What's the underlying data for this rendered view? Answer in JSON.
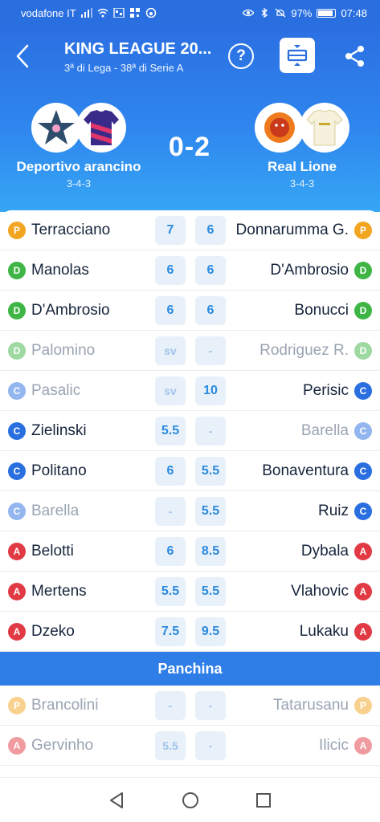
{
  "status": {
    "carrier": "vodafone IT",
    "battery": "97%",
    "time": "07:48"
  },
  "header": {
    "title": "KING LEAGUE 20...",
    "subtitle": "3ª di Lega - 38ª di Serie A",
    "help_label": "?"
  },
  "match": {
    "home": {
      "name": "Deportivo arancino",
      "formation": "3-4-3"
    },
    "away": {
      "name": "Real Lione",
      "formation": "3-4-3"
    },
    "score": "0-2"
  },
  "starters": [
    {
      "home_role": "P",
      "home_name": "Terracciano",
      "home_vote": "7",
      "away_vote": "6",
      "away_name": "Donnarumma G.",
      "away_role": "P",
      "home_dim": false,
      "away_dim": false
    },
    {
      "home_role": "D",
      "home_name": "Manolas",
      "home_vote": "6",
      "away_vote": "6",
      "away_name": "D'Ambrosio",
      "away_role": "D",
      "home_dim": false,
      "away_dim": false
    },
    {
      "home_role": "D",
      "home_name": "D'Ambrosio",
      "home_vote": "6",
      "away_vote": "6",
      "away_name": "Bonucci",
      "away_role": "D",
      "home_dim": false,
      "away_dim": false
    },
    {
      "home_role": "D",
      "home_name": "Palomino",
      "home_vote": "sv",
      "away_vote": "-",
      "away_name": "Rodriguez R.",
      "away_role": "D",
      "home_dim": true,
      "away_dim": true
    },
    {
      "home_role": "C",
      "home_name": "Pasalic",
      "home_vote": "sv",
      "away_vote": "10",
      "away_name": "Perisic",
      "away_role": "C",
      "home_dim": true,
      "away_dim": false
    },
    {
      "home_role": "C",
      "home_name": "Zielinski",
      "home_vote": "5.5",
      "away_vote": "-",
      "away_name": "Barella",
      "away_role": "C",
      "home_dim": false,
      "away_dim": true
    },
    {
      "home_role": "C",
      "home_name": "Politano",
      "home_vote": "6",
      "away_vote": "5.5",
      "away_name": "Bonaventura",
      "away_role": "C",
      "home_dim": false,
      "away_dim": false
    },
    {
      "home_role": "C",
      "home_name": "Barella",
      "home_vote": "-",
      "away_vote": "5.5",
      "away_name": "Ruiz",
      "away_role": "C",
      "home_dim": true,
      "away_dim": false
    },
    {
      "home_role": "A",
      "home_name": "Belotti",
      "home_vote": "6",
      "away_vote": "8.5",
      "away_name": "Dybala",
      "away_role": "A",
      "home_dim": false,
      "away_dim": false
    },
    {
      "home_role": "A",
      "home_name": "Mertens",
      "home_vote": "5.5",
      "away_vote": "5.5",
      "away_name": "Vlahovic",
      "away_role": "A",
      "home_dim": false,
      "away_dim": false
    },
    {
      "home_role": "A",
      "home_name": "Dzeko",
      "home_vote": "7.5",
      "away_vote": "9.5",
      "away_name": "Lukaku",
      "away_role": "A",
      "home_dim": false,
      "away_dim": false
    }
  ],
  "bench_title": "Panchina",
  "bench": [
    {
      "home_role": "P",
      "home_name": "Brancolini",
      "home_vote": "-",
      "away_vote": "-",
      "away_name": "Tatarusanu",
      "away_role": "P",
      "home_dim": true,
      "away_dim": true
    },
    {
      "home_role": "A",
      "home_name": "Gervinho",
      "home_vote": "5.5",
      "away_vote": "-",
      "away_name": "Ilicic",
      "away_role": "A",
      "home_dim": true,
      "away_dim": true
    }
  ],
  "colors": {
    "primary": "#2a6fe0",
    "role_P": "#f2a521",
    "role_D": "#3fb546",
    "role_C": "#2a6fe0",
    "role_A": "#e13a44"
  }
}
